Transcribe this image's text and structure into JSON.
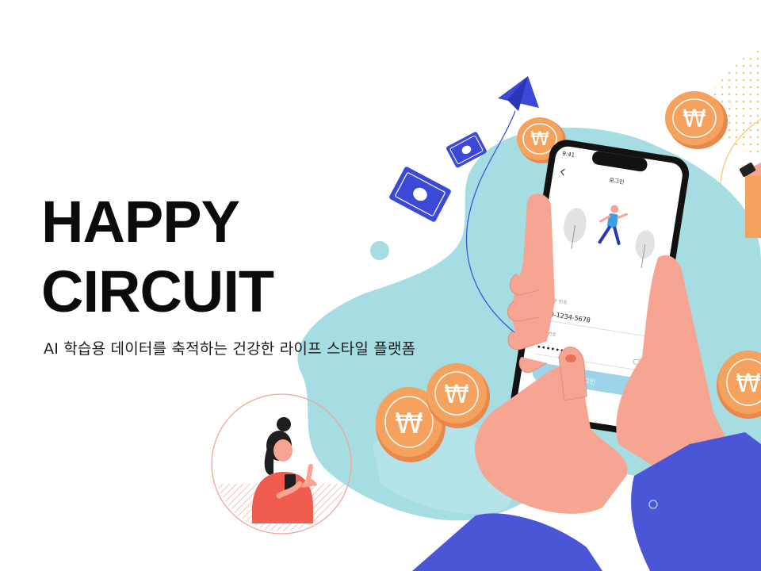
{
  "hero": {
    "title_line1": "HAPPY",
    "title_line2": "CIRCUIT",
    "subtitle": "AI 학습용 데이터를 축적하는 건강한 라이프 스타일 플랫폼"
  },
  "phone": {
    "status_time": "9:41",
    "screen_title": "로그인",
    "back_icon": "chevron-left-icon",
    "phone_label": "휴대폰 번호",
    "phone_value": "010-1234-5678",
    "password_label": "비밀번호",
    "password_value": "••••••••",
    "login_button": "로그인"
  },
  "coins": {
    "symbol": "₩"
  },
  "colors": {
    "blob": "#a6dde3",
    "coin": "#f4a25e",
    "coin_edge": "#e8884a",
    "skin": "#f6a592",
    "sleeve": "#4a56d6",
    "accent_blue": "#3b49d6",
    "login_button": "#9ed4ea"
  }
}
